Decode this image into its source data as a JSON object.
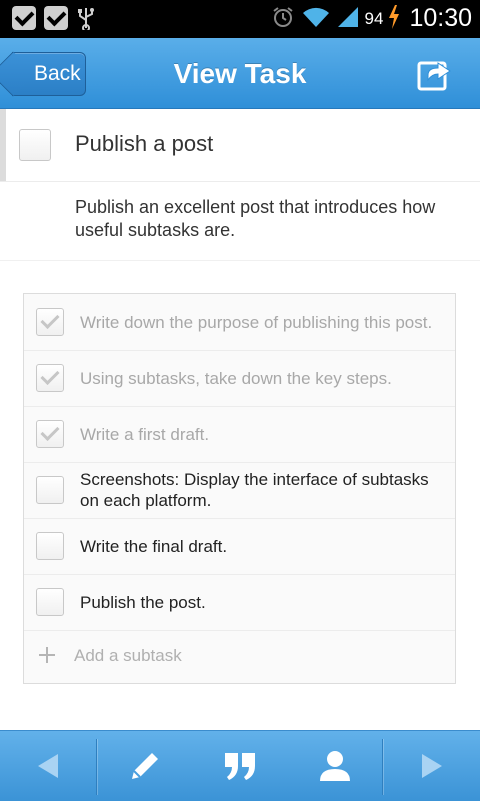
{
  "status_bar": {
    "battery": "94",
    "time": "10:30",
    "icons": [
      "check-notification-icon",
      "check-notification-icon",
      "usb-icon",
      "alarm-icon",
      "wifi-icon",
      "signal-icon",
      "battery-charging-icon"
    ]
  },
  "header": {
    "back_label": "Back",
    "title": "View Task",
    "action_icon": "share-icon"
  },
  "task": {
    "title": "Publish a post",
    "description": "Publish an excellent post that introduces how useful subtasks are.",
    "completed": false
  },
  "subtasks": [
    {
      "label": "Write down the purpose of publishing this post.",
      "done": true
    },
    {
      "label": "Using subtasks, take down the key steps.",
      "done": true
    },
    {
      "label": "Write a first draft.",
      "done": true
    },
    {
      "label": "Screenshots: Display the interface of subtasks on each platform.",
      "done": false
    },
    {
      "label": "Write the final draft.",
      "done": false
    },
    {
      "label": "Publish the post.",
      "done": false
    }
  ],
  "add_subtask": {
    "placeholder": "Add a subtask",
    "icon": "plus-icon"
  },
  "bottom_bar": {
    "buttons": [
      "previous-icon",
      "edit-icon",
      "comment-icon",
      "assign-icon",
      "next-icon"
    ]
  },
  "colors": {
    "header_blue": "#2f8fd8",
    "done_text": "#a8a8a8",
    "text": "#333333"
  }
}
